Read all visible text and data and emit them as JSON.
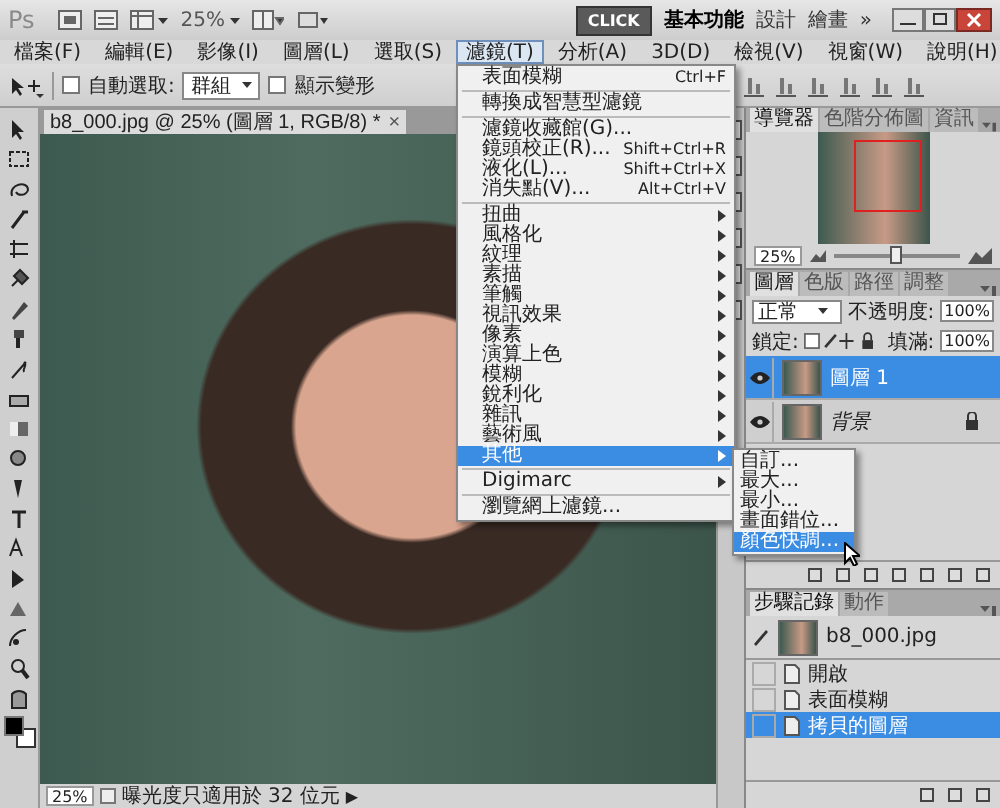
{
  "app_bar": {
    "logo": "Ps",
    "zoom": "25%",
    "click_button": "CLICK",
    "workspaces": [
      {
        "label": "基本功能",
        "selected": true
      },
      {
        "label": "設計",
        "selected": false
      },
      {
        "label": "繪畫",
        "selected": false
      }
    ],
    "more": "»"
  },
  "menu_bar": [
    {
      "label": "檔案(F)",
      "selected": false
    },
    {
      "label": "編輯(E)",
      "selected": false
    },
    {
      "label": "影像(I)",
      "selected": false
    },
    {
      "label": "圖層(L)",
      "selected": false
    },
    {
      "label": "選取(S)",
      "selected": false
    },
    {
      "label": "濾鏡(T)",
      "selected": true
    },
    {
      "label": "分析(A)",
      "selected": false
    },
    {
      "label": "3D(D)",
      "selected": false
    },
    {
      "label": "檢視(V)",
      "selected": false
    },
    {
      "label": "視窗(W)",
      "selected": false
    },
    {
      "label": "說明(H)",
      "selected": false
    }
  ],
  "options_bar": {
    "auto_select_checked": false,
    "auto_select_label": "自動選取:",
    "auto_select_value": "群組",
    "show_transform_checked": false,
    "show_transform_label": "顯示變形"
  },
  "document": {
    "tab_title": "b8_000.jpg @ 25% (圖層 1, RGB/8) *",
    "close": "×",
    "status_zoom": "25%",
    "status_info": "曝光度只適用於 32 位元",
    "status_arrow": "▶"
  },
  "filter_menu": {
    "items": [
      {
        "kind": "item",
        "label": "表面模糊",
        "shortcut": "Ctrl+F"
      },
      {
        "kind": "separator"
      },
      {
        "kind": "item",
        "label": "轉換成智慧型濾鏡"
      },
      {
        "kind": "separator"
      },
      {
        "kind": "item",
        "label": "濾鏡收藏館(G)..."
      },
      {
        "kind": "item",
        "label": "鏡頭校正(R)...",
        "shortcut": "Shift+Ctrl+R"
      },
      {
        "kind": "item",
        "label": "液化(L)...",
        "shortcut": "Shift+Ctrl+X"
      },
      {
        "kind": "item",
        "label": "消失點(V)...",
        "shortcut": "Alt+Ctrl+V"
      },
      {
        "kind": "separator"
      },
      {
        "kind": "submenu",
        "label": "扭曲",
        "selected": false
      },
      {
        "kind": "submenu",
        "label": "風格化",
        "selected": false
      },
      {
        "kind": "submenu",
        "label": "紋理",
        "selected": false
      },
      {
        "kind": "submenu",
        "label": "素描",
        "selected": false
      },
      {
        "kind": "submenu",
        "label": "筆觸",
        "selected": false
      },
      {
        "kind": "submenu",
        "label": "視訊效果",
        "selected": false
      },
      {
        "kind": "submenu",
        "label": "像素",
        "selected": false
      },
      {
        "kind": "submenu",
        "label": "演算上色",
        "selected": false
      },
      {
        "kind": "submenu",
        "label": "模糊",
        "selected": false
      },
      {
        "kind": "submenu",
        "label": "銳利化",
        "selected": false
      },
      {
        "kind": "submenu",
        "label": "雜訊",
        "selected": false
      },
      {
        "kind": "submenu",
        "label": "藝術風",
        "selected": false
      },
      {
        "kind": "submenu",
        "label": "其他",
        "selected": true
      },
      {
        "kind": "separator"
      },
      {
        "kind": "submenu",
        "label": "Digimarc",
        "selected": false
      },
      {
        "kind": "separator"
      },
      {
        "kind": "item",
        "label": "瀏覽網上濾鏡..."
      }
    ]
  },
  "submenu": {
    "items": [
      {
        "label": "自訂...",
        "selected": false
      },
      {
        "label": "最大...",
        "selected": false
      },
      {
        "label": "最小...",
        "selected": false
      },
      {
        "label": "畫面錯位...",
        "selected": false
      },
      {
        "label": "顏色快調...",
        "selected": true
      }
    ]
  },
  "navigator": {
    "tabs": [
      {
        "label": "導覽器",
        "selected": true
      },
      {
        "label": "色階分佈圖",
        "selected": false
      },
      {
        "label": "資訊",
        "selected": false
      }
    ],
    "zoom": "25%",
    "level": 0.5
  },
  "layers": {
    "tabs": [
      {
        "label": "圖層",
        "selected": true
      },
      {
        "label": "色版",
        "selected": false
      },
      {
        "label": "路徑",
        "selected": false
      },
      {
        "label": "調整",
        "selected": false
      }
    ],
    "blend_mode": "正常",
    "opacity_label": "不透明度:",
    "opacity": "100%",
    "lock_label": "鎖定:",
    "fill_label": "填滿:",
    "fill": "100%",
    "items": [
      {
        "name": "圖層 1",
        "selected": true,
        "visible": true,
        "locked": false
      },
      {
        "name": "背景",
        "selected": false,
        "visible": true,
        "locked": true
      }
    ]
  },
  "history": {
    "tabs": [
      {
        "label": "步驟記錄",
        "selected": true
      },
      {
        "label": "動作",
        "selected": false
      }
    ],
    "snapshot": "b8_000.jpg",
    "steps": [
      {
        "label": "開啟",
        "selected": false
      },
      {
        "label": "表面模糊",
        "selected": false
      },
      {
        "label": "拷貝的圖層",
        "selected": true
      }
    ]
  }
}
